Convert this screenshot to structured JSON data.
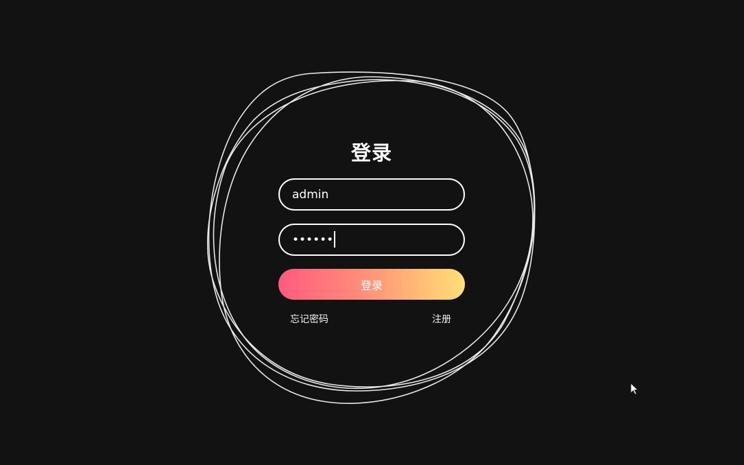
{
  "login": {
    "title": "登录",
    "username_value": "admin",
    "password_mask": "••••••",
    "submit_label": "登录",
    "forgot_label": "忘记密码",
    "register_label": "注册"
  },
  "theme": {
    "background": "#121212",
    "ring_color": "#e9e9e9",
    "button_gradient_start": "#ff5a7e",
    "button_gradient_end": "#ffdf78"
  },
  "icons": {
    "pointer": "mouse-cursor-icon"
  }
}
